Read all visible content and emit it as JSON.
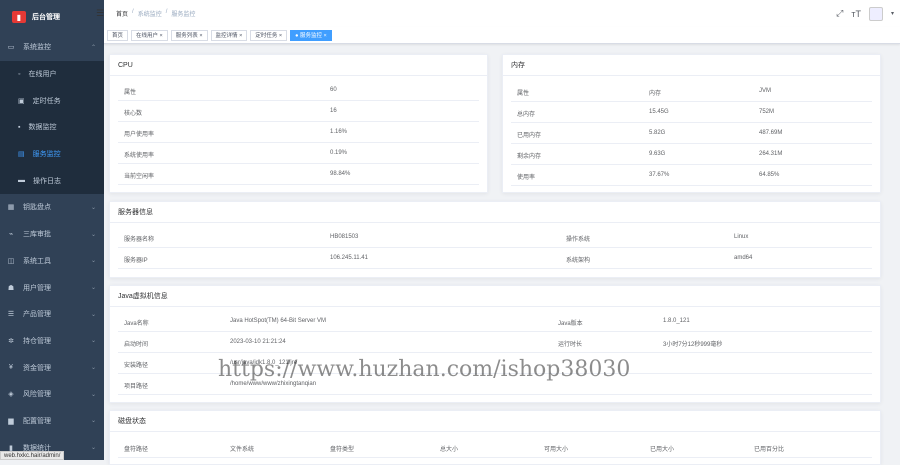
{
  "app": {
    "title": "后台管理"
  },
  "sidebar": {
    "items": [
      {
        "icon": "monitor-icon",
        "label": "系统监控",
        "expanded": true
      },
      {
        "icon": "user-icon",
        "label": "在线用户",
        "sub": true
      },
      {
        "icon": "job-icon",
        "label": "定时任务",
        "sub": true
      },
      {
        "icon": "data-icon",
        "label": "数据监控",
        "sub": true
      },
      {
        "icon": "server-icon",
        "label": "服务监控",
        "sub": true,
        "active": true
      },
      {
        "icon": "log-icon",
        "label": "操作日志",
        "sub": true
      },
      {
        "icon": "grid-icon",
        "label": "钥匙盘点"
      },
      {
        "icon": "code-icon",
        "label": "三库审批"
      },
      {
        "icon": "chart-icon",
        "label": "系统工具"
      },
      {
        "icon": "people-icon",
        "label": "用户管理"
      },
      {
        "icon": "list-icon",
        "label": "产品管理"
      },
      {
        "icon": "gear-icon",
        "label": "持仓管理"
      },
      {
        "icon": "yen-icon",
        "label": "资金管理"
      },
      {
        "icon": "shield-icon",
        "label": "风险管理"
      },
      {
        "icon": "doc-icon",
        "label": "配置管理"
      },
      {
        "icon": "bar-icon",
        "label": "数据统计"
      }
    ]
  },
  "status_url": "web.hxkc.hair/admin/",
  "header": {
    "breadcrumb": [
      "首页",
      "系统监控",
      "服务监控"
    ]
  },
  "tags": [
    {
      "label": "首页"
    },
    {
      "label": "在线用户"
    },
    {
      "label": "服务列表"
    },
    {
      "label": "监控详情"
    },
    {
      "label": "定时任务"
    },
    {
      "label": "服务监控",
      "active": true
    }
  ],
  "cpu": {
    "title": "CPU",
    "headers": [
      "属性",
      "值"
    ],
    "rows": [
      [
        "属性",
        "60"
      ],
      [
        "核心数",
        "16"
      ],
      [
        "用户使用率",
        "1.16%"
      ],
      [
        "系统使用率",
        "0.19%"
      ],
      [
        "当前空闲率",
        "98.84%"
      ]
    ]
  },
  "memory": {
    "title": "内存",
    "headers": [
      "属性",
      "内存",
      "JVM"
    ],
    "rows": [
      [
        "总内存",
        "15.45G",
        "752M"
      ],
      [
        "已用内存",
        "5.82G",
        "487.69M"
      ],
      [
        "剩余内存",
        "9.63G",
        "264.31M"
      ],
      [
        "使用率",
        "37.67%",
        "64.85%"
      ]
    ]
  },
  "server": {
    "title": "服务器信息",
    "rows": [
      [
        "服务器名称",
        "HB081503",
        "操作系统",
        "Linux"
      ],
      [
        "服务器IP",
        "106.245.11.41",
        "系统架构",
        "amd64"
      ]
    ]
  },
  "jvm": {
    "title": "Java虚拟机信息",
    "rows": [
      [
        "Java名称",
        "Java HotSpot(TM) 64-Bit Server VM",
        "Java版本",
        "1.8.0_121"
      ],
      [
        "启动时间",
        "2023-03-10 21:21:24",
        "运行时长",
        "3小时7分12秒999毫秒"
      ],
      [
        "安装路径",
        "/usr/java/jdk1.8.0_121/jre",
        "",
        ""
      ],
      [
        "项目路径",
        "/home/www/www/zhixingtanqian",
        "",
        ""
      ]
    ]
  },
  "disk": {
    "title": "磁盘状态",
    "headers": [
      "盘符路径",
      "文件系统",
      "盘符类型",
      "总大小",
      "可用大小",
      "已用大小",
      "已用百分比"
    ]
  },
  "watermark": "https://www.huzhan.com/ishop38030"
}
